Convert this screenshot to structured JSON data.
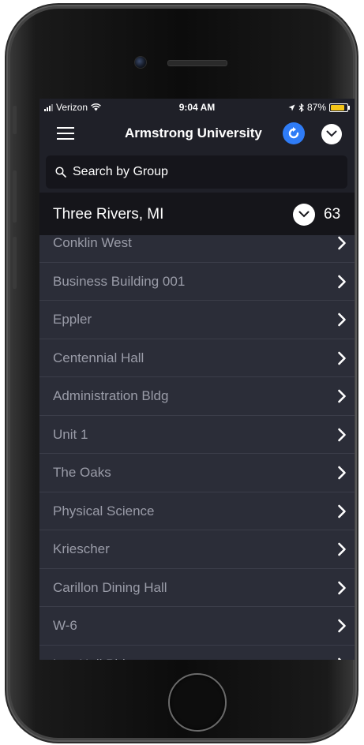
{
  "status_bar": {
    "carrier": "Verizon",
    "time": "9:04 AM",
    "battery": "87%",
    "battery_level": 0.87,
    "battery_color": "#f5c518"
  },
  "navbar": {
    "menu_icon": "hamburger-icon",
    "title": "Armstrong University",
    "refresh_icon": "refresh-icon",
    "refresh_color": "#2f7cf6",
    "dropdown_icon": "chevron-down-icon"
  },
  "search": {
    "placeholder": "Search by Group",
    "value": ""
  },
  "group": {
    "name": "Three Rivers, MI",
    "count": "63",
    "toggle_icon": "chevron-down-icon"
  },
  "list": {
    "items": [
      {
        "label": "Conklin West"
      },
      {
        "label": "Business Building 001"
      },
      {
        "label": "Eppler"
      },
      {
        "label": "Centennial Hall"
      },
      {
        "label": "Administration Bldg"
      },
      {
        "label": "Unit 1"
      },
      {
        "label": "The Oaks"
      },
      {
        "label": "Physical Science"
      },
      {
        "label": "Kriescher"
      },
      {
        "label": "Carillon Dining Hall"
      },
      {
        "label": "W-6"
      },
      {
        "label": "Lee Hall Bldg"
      }
    ],
    "row_icon": "chevron-right-icon"
  }
}
